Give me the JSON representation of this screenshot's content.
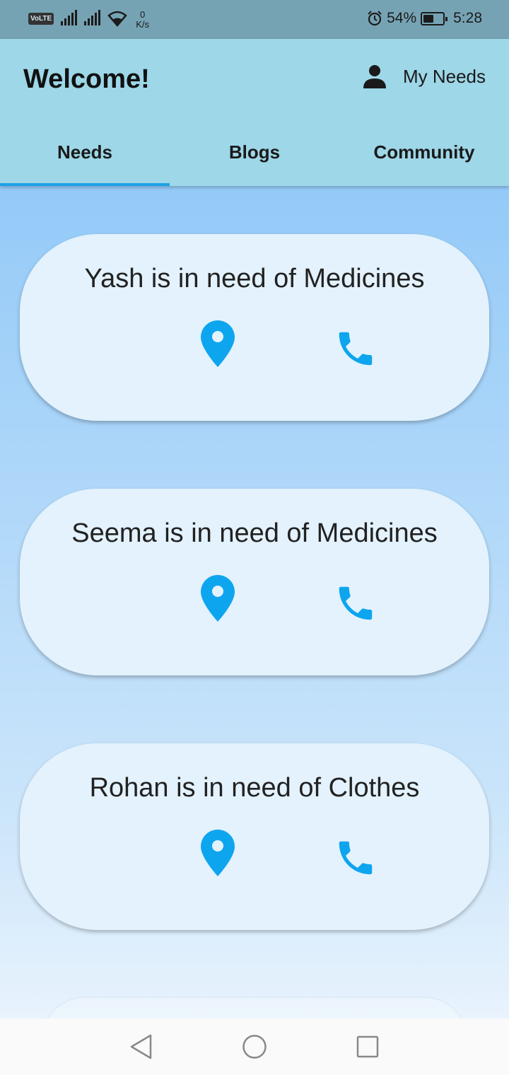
{
  "status_bar": {
    "volte": "VoLTE",
    "net_speed_value": "0",
    "net_speed_unit": "K/s",
    "battery": "54%",
    "time": "5:28",
    "battery_level": 0.54
  },
  "app_bar": {
    "title": "Welcome!",
    "my_needs_label": "My Needs"
  },
  "tabs": [
    {
      "label": "Needs",
      "active": true
    },
    {
      "label": "Blogs",
      "active": false
    },
    {
      "label": "Community",
      "active": false
    }
  ],
  "needs": [
    {
      "text": "Yash is in need of Medicines",
      "icons": [
        "location-pin-icon",
        "phone-icon"
      ]
    },
    {
      "text": "Seema is in need of Medicines",
      "icons": [
        "location-pin-icon",
        "phone-icon"
      ]
    },
    {
      "text": "Rohan is in need of Clothes",
      "icons": [
        "location-pin-icon",
        "phone-icon"
      ]
    }
  ],
  "colors": {
    "app_bar": "#9dd7e8",
    "accent": "#1da1e6",
    "card": "#e3f2fd",
    "icon": "#0ea5ef"
  },
  "nav_bar": [
    "back-icon",
    "home-icon",
    "recents-icon"
  ]
}
